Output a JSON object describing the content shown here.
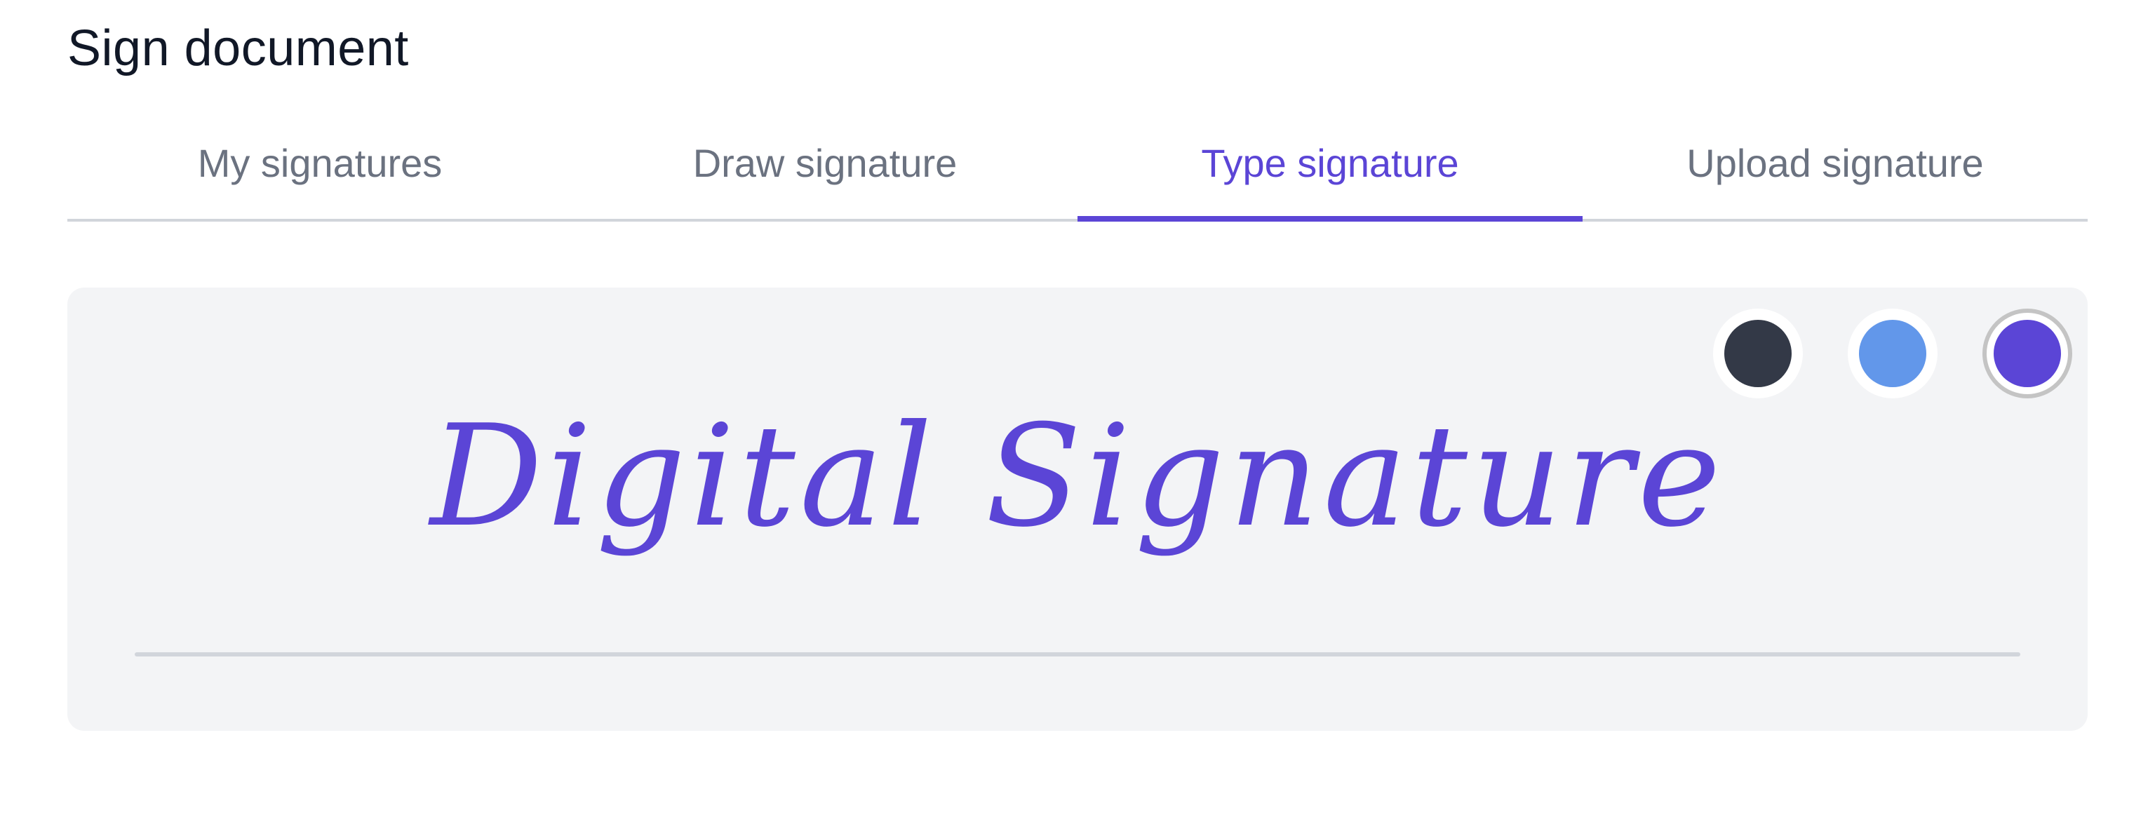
{
  "page": {
    "title": "Sign document"
  },
  "tabs": [
    {
      "label": "My signatures",
      "active": false
    },
    {
      "label": "Draw signature",
      "active": false
    },
    {
      "label": "Type signature",
      "active": true
    },
    {
      "label": "Upload signature",
      "active": false
    }
  ],
  "signature": {
    "text": "Digital Signature",
    "color": "#5b45d6"
  },
  "colors": [
    {
      "name": "dark",
      "hex": "#333947",
      "selected": false
    },
    {
      "name": "blue",
      "hex": "#6297ea",
      "selected": false
    },
    {
      "name": "purple",
      "hex": "#5b45d6",
      "selected": true
    }
  ],
  "theme": {
    "accent": "#5b45d6",
    "tab_text": "#6b7280",
    "title_text": "#111827",
    "panel_bg": "#f3f4f6",
    "divider": "#d1d5db"
  }
}
